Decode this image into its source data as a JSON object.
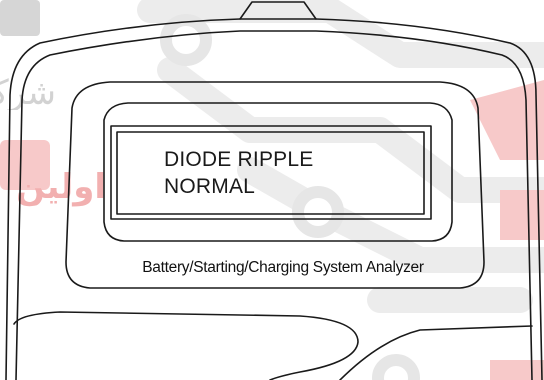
{
  "display": {
    "line1": "DIODE RIPPLE",
    "line2": "NORMAL"
  },
  "device": {
    "label": "Battery/Starting/Charging System Analyzer"
  },
  "watermark": {
    "line1": "شرکت",
    "line2": "اولین",
    "colors": {
      "grey": "#d8d8d8",
      "red": "#ef9a9a"
    }
  },
  "colors": {
    "outline": "#1a1a1a",
    "background": "#ffffff"
  }
}
